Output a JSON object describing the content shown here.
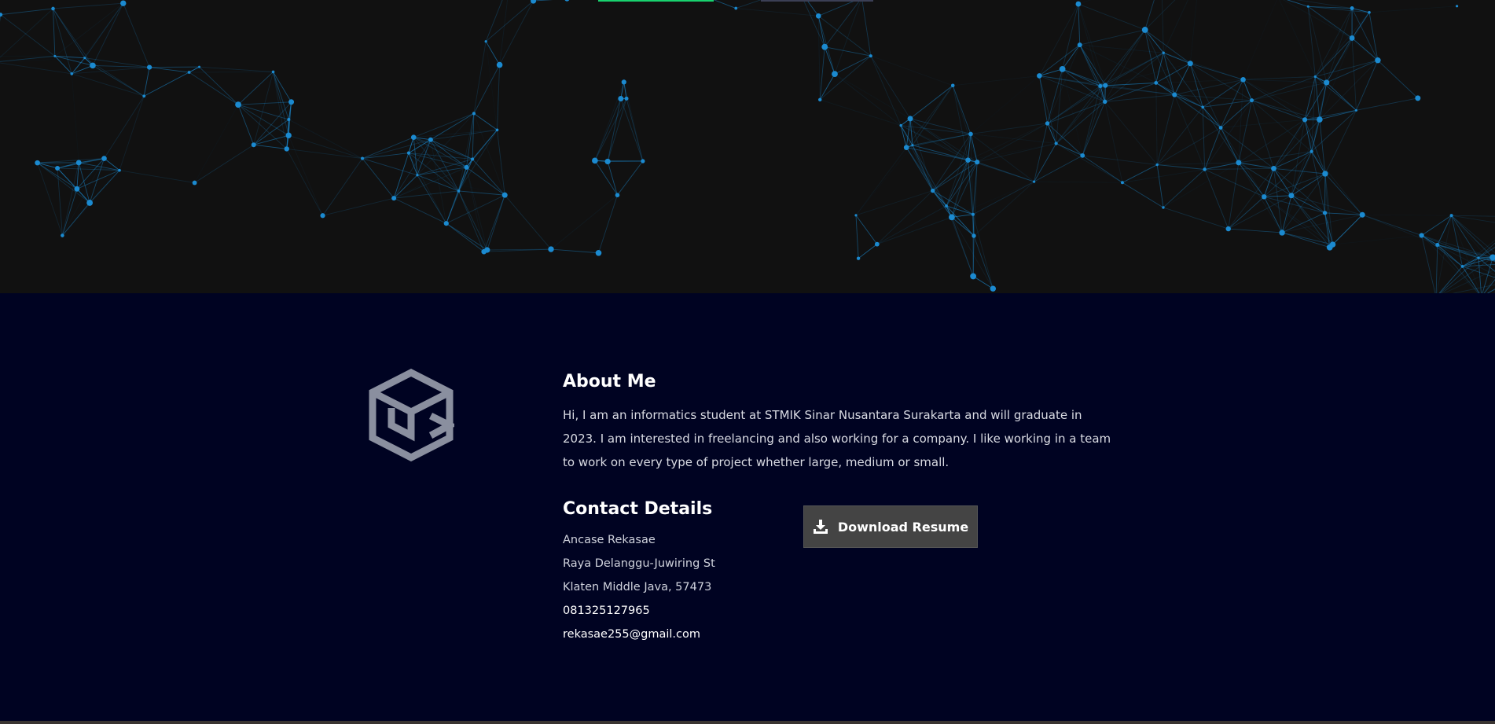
{
  "hero": {
    "buttons": [
      {
        "kind": "primary",
        "color": "#18d26e"
      },
      {
        "kind": "secondary",
        "color": "#3b3f55"
      }
    ],
    "particles_color": "#1b8ad0"
  },
  "about": {
    "title": "About Me",
    "text": "Hi, I am an informatics student at STMIK Sinar Nusantara Surakarta and will graduate in 2023. I am interested in freelancing and also working for a company. I like working in a team to work on every type of project whether large, medium or small."
  },
  "contact": {
    "title": "Contact Details",
    "name": "Ancase Rekasae",
    "address_line1": "Raya Delanggu-Juwiring St",
    "address_line2": "Klaten Middle Java, 57473",
    "phone": "081325127965",
    "email": "rekasae255@gmail.com"
  },
  "download": {
    "label": "Download Resume",
    "icon": "download-icon"
  },
  "colors": {
    "hero_bg": "#111111",
    "section_bg": "#000322",
    "button_bg": "#444444",
    "logo": "#8a8f9f"
  }
}
